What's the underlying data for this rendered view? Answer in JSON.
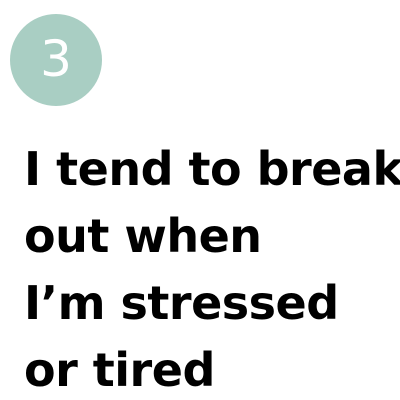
{
  "step": {
    "number": "3",
    "badge_color": "#a9cec3"
  },
  "statement": {
    "lines": [
      "I tend to break",
      "out when",
      "I’m stressed",
      "or tired"
    ],
    "text_color": "#000000"
  },
  "background_color": "#ffffff"
}
